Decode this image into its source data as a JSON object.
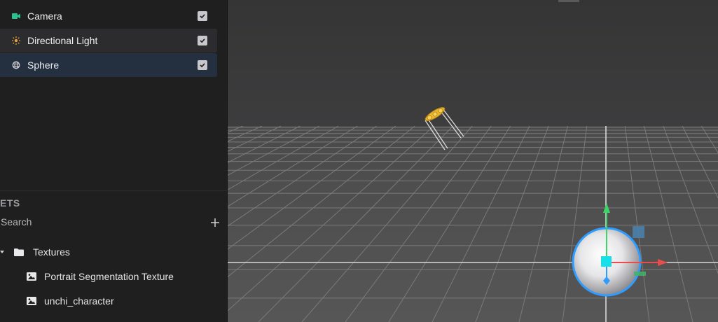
{
  "hierarchy": {
    "items": [
      {
        "label": "Camera",
        "icon": "camera-icon",
        "checked": true
      },
      {
        "label": "Directional Light",
        "icon": "sun-icon",
        "checked": true
      },
      {
        "label": "Sphere",
        "icon": "globe-icon",
        "checked": true
      }
    ]
  },
  "assets": {
    "title": "ETS",
    "search_placeholder": "Search",
    "add_icon": "plus-icon",
    "folder": {
      "label": "Textures",
      "icon": "folder-icon",
      "expanded": true
    },
    "items": [
      {
        "label": "Portrait Segmentation Texture",
        "icon": "image-icon"
      },
      {
        "label": "unchi_character",
        "icon": "image-icon"
      }
    ]
  },
  "colors": {
    "panel_bg": "#1f1f20",
    "selected_row": "#243040",
    "hover_row": "#2c2c2e",
    "camera_icon": "#27c48e",
    "sun_icon": "#e6a23c",
    "viewport_sky": "#3a3a3b",
    "viewport_floor": "#505050",
    "gizmo_x": "#e84d4d",
    "gizmo_y": "#3fd46a",
    "gizmo_z": "#2f9cff",
    "gizmo_center": "#18e0e8",
    "light_gizmo": "#e9b52a"
  }
}
